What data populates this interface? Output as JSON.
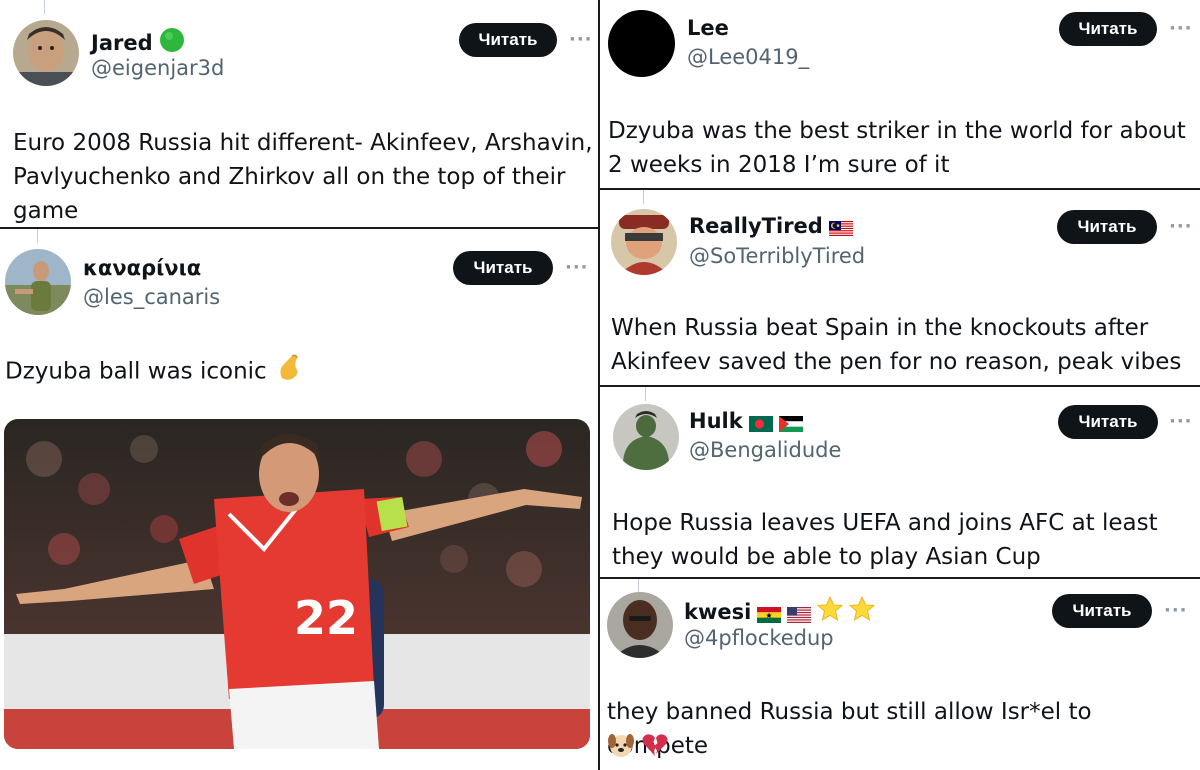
{
  "follow_label": "Читать",
  "more_label": "···",
  "tweets": [
    {
      "name": "Jared",
      "handle": "@eigenjar3d",
      "badges": [
        "green-circle"
      ],
      "text": "Euro 2008 Russia hit different- Akinfeev, Arshavin, Pavlyuchenko and Zhirkov all on the top of their game"
    },
    {
      "name": "καναρίνια",
      "handle": "@les_canaris",
      "badges": [],
      "text": "Dzyuba ball was iconic",
      "text_emoji": "pinching-hand",
      "image": "footballer-celebrating-photo",
      "image_jersey_number": "22"
    },
    {
      "name": "Lee",
      "handle": "@Lee0419_",
      "badges": [],
      "text": "Dzyuba was the best striker in the world for about 2 weeks in 2018 I’m sure of it"
    },
    {
      "name": "ReallyTired",
      "handle": "@SoTerriblyTired",
      "badges": [
        "flag-malaysia"
      ],
      "text": "When Russia beat Spain in the knockouts after Akinfeev saved the pen for no reason, peak vibes"
    },
    {
      "name": "Hulk",
      "handle": "@Bengalidude",
      "badges": [
        "flag-bangladesh",
        "flag-palestine"
      ],
      "text": "Hope Russia leaves UEFA and joins AFC at least they would be able to play Asian Cup"
    },
    {
      "name": "kwesi",
      "handle": "@4pflockedup",
      "badges": [
        "flag-ghana",
        "flag-usa",
        "star",
        "star"
      ],
      "text": "they banned Russia but still allow Isr*el to compete",
      "text_emoji": [
        "dog-face",
        "broken-heart"
      ]
    }
  ],
  "colors": {
    "follow_bg": "#0f1419",
    "handle": "#536471",
    "divider": "#1a1a1a"
  }
}
